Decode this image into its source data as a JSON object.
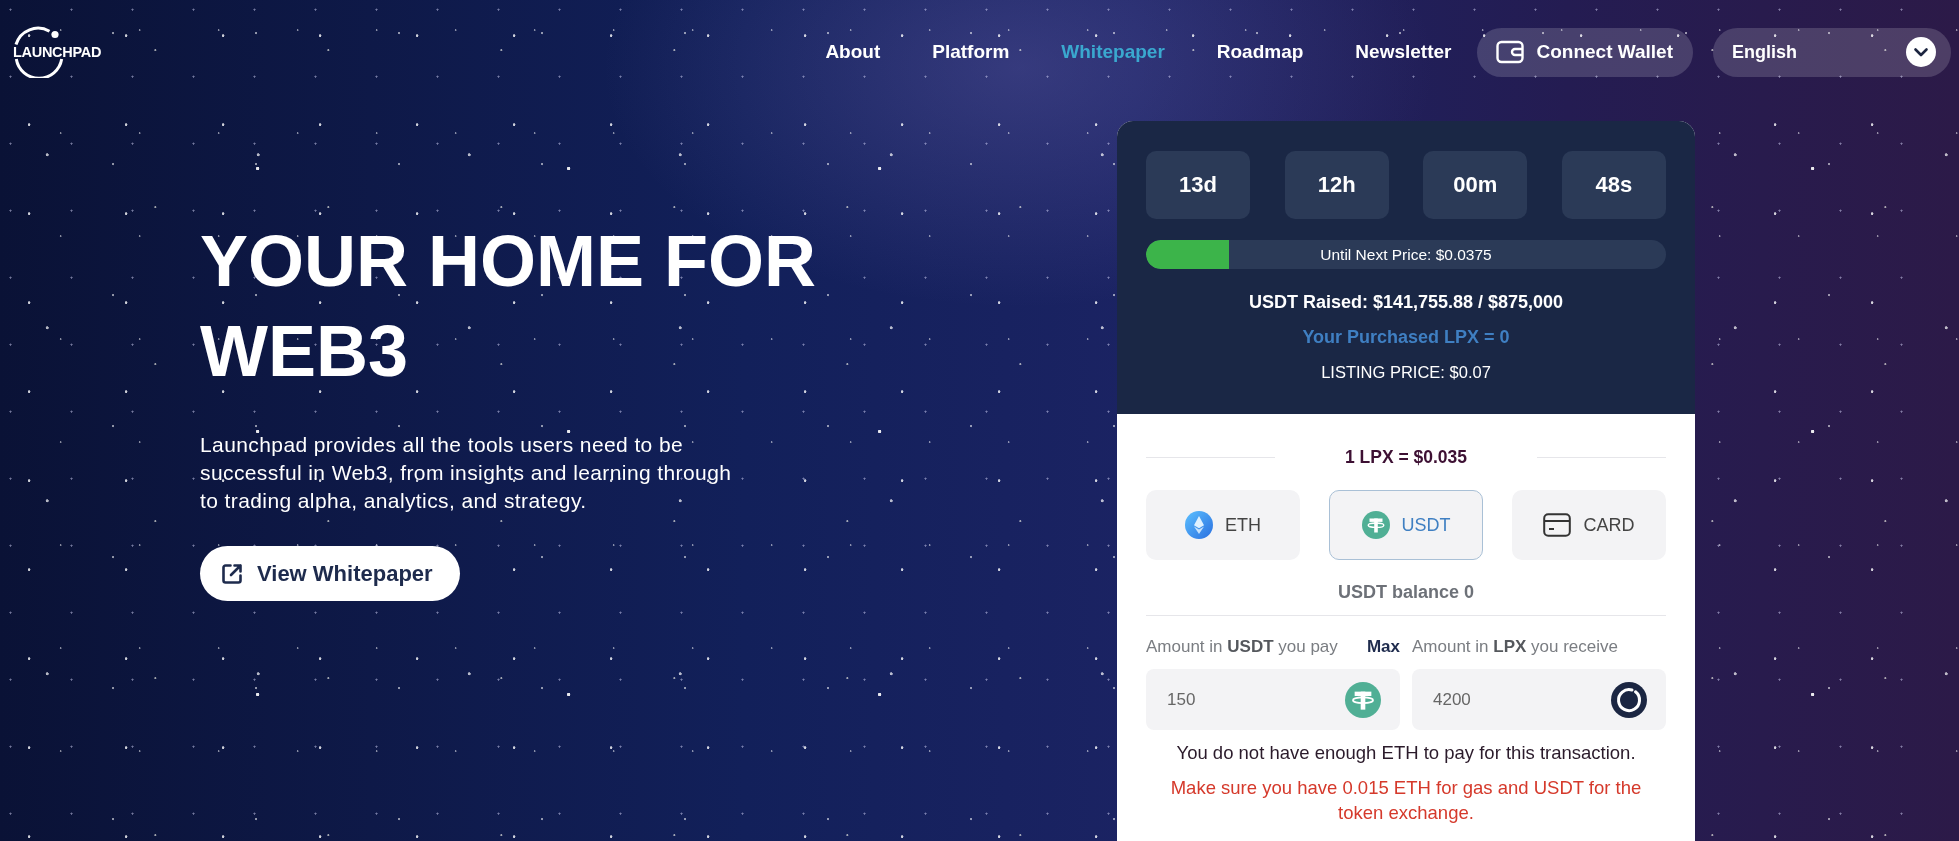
{
  "header": {
    "logo": "LAUNCHPAD",
    "nav": [
      {
        "label": "About",
        "selected": false
      },
      {
        "label": "Platform",
        "selected": false
      },
      {
        "label": "Whitepaper",
        "selected": true
      },
      {
        "label": "Roadmap",
        "selected": false
      },
      {
        "label": "Newsletter",
        "selected": false
      }
    ],
    "connect_wallet": "Connect Wallet",
    "language": "English"
  },
  "hero": {
    "title": "YOUR HOME FOR WEB3",
    "description": "Launchpad provides all the tools users need to be successful in Web3, from insights and learning through to trading alpha, analytics, and strategy.",
    "button": "View Whitepaper"
  },
  "presale": {
    "countdown": [
      "13d",
      "12h",
      "00m",
      "48s"
    ],
    "progress": {
      "level": 0.16,
      "label": "Until Next Price: $0.0375"
    },
    "raised": "USDT Raised: $141,755.88 / $875,000",
    "purchased": "Your Purchased LPX = 0",
    "listing_price": "LISTING PRICE: $0.07",
    "rate": "1 LPX = $0.035",
    "currencies": [
      {
        "kind": "eth",
        "label": "ETH",
        "selected": false
      },
      {
        "kind": "usdt",
        "label": "USDT",
        "selected": true
      },
      {
        "kind": "card",
        "label": "CARD",
        "selected": false
      }
    ],
    "balance": "USDT balance 0",
    "max": "Max",
    "amount_fields": [
      {
        "kind": "usdt",
        "label": "Amount in **USDT** you pay",
        "value": "150"
      },
      {
        "kind": "lpx",
        "label": "Amount in **LPX** you receive",
        "value": "4200"
      }
    ],
    "error": "You do not have enough ETH to pay for this transaction.",
    "warning": "Make sure you have 0.015 ETH for gas and USDT for the token exchange."
  }
}
